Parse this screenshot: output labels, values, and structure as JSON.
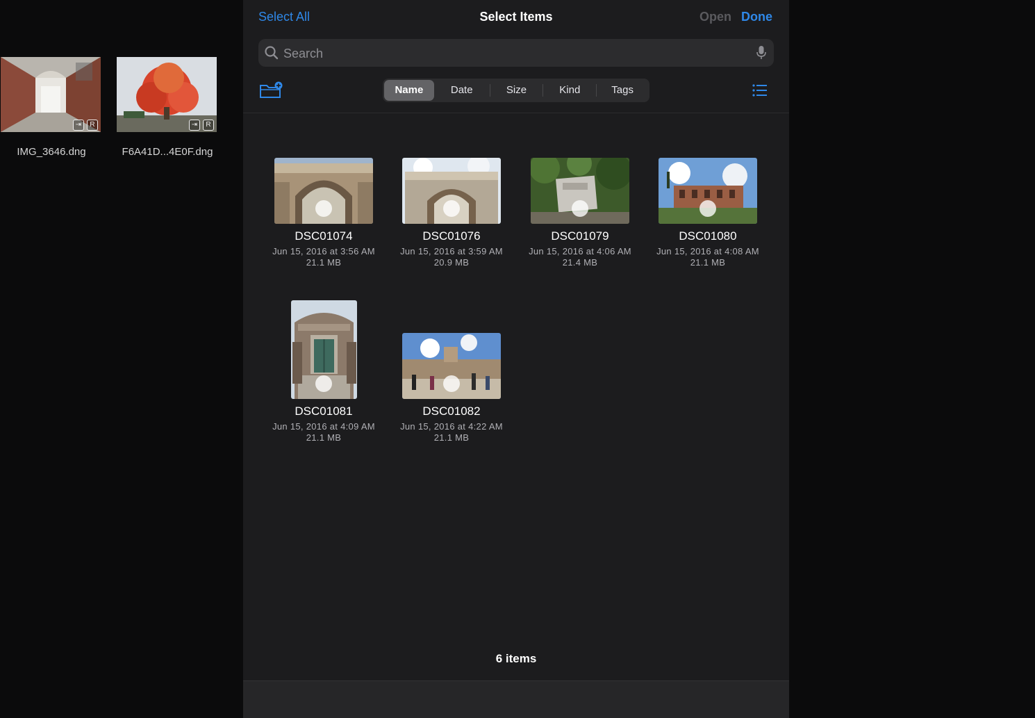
{
  "background": {
    "items": [
      {
        "name": "IMG_3646.dng"
      },
      {
        "name": "F6A41D...4E0F.dng"
      }
    ],
    "badge_r": "R"
  },
  "navbar": {
    "select_all": "Select All",
    "title": "Select Items",
    "open": "Open",
    "done": "Done"
  },
  "search": {
    "placeholder": "Search"
  },
  "sort": {
    "segments": [
      "Name",
      "Date",
      "Size",
      "Kind",
      "Tags"
    ],
    "selected": "Name"
  },
  "files": [
    {
      "name": "DSC01074",
      "date": "Jun 15, 2016 at 3:56 AM",
      "size": "21.1 MB"
    },
    {
      "name": "DSC01076",
      "date": "Jun 15, 2016 at 3:59 AM",
      "size": "20.9 MB"
    },
    {
      "name": "DSC01079",
      "date": "Jun 15, 2016 at 4:06 AM",
      "size": "21.4 MB"
    },
    {
      "name": "DSC01080",
      "date": "Jun 15, 2016 at 4:08 AM",
      "size": "21.1 MB"
    },
    {
      "name": "DSC01081",
      "date": "Jun 15, 2016 at 4:09 AM",
      "size": "21.1 MB"
    },
    {
      "name": "DSC01082",
      "date": "Jun 15, 2016 at 4:22 AM",
      "size": "21.1 MB"
    }
  ],
  "footer": {
    "count": "6 items"
  },
  "colors": {
    "accent": "#2f88e8",
    "sheet_bg": "#1c1c1e",
    "page_bg": "#0b0b0c"
  }
}
